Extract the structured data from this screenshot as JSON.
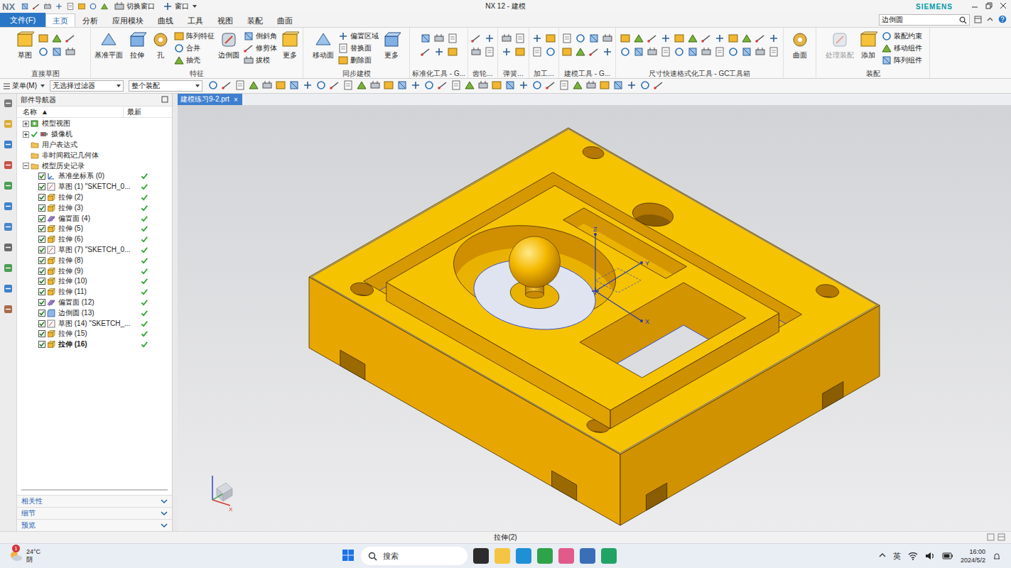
{
  "titlebar": {
    "logo": "NX",
    "quick_access": [
      {
        "label": "切换窗口"
      },
      {
        "label": "窗口"
      }
    ],
    "title": "NX 12 - 建模",
    "brand": "SIEMENS"
  },
  "menu": {
    "file": "文件(F)",
    "tabs": [
      {
        "label": "主页",
        "selected": true
      },
      {
        "label": "分析",
        "selected": false
      },
      {
        "label": "应用模块",
        "selected": false
      },
      {
        "label": "曲线",
        "selected": false
      },
      {
        "label": "工具",
        "selected": false
      },
      {
        "label": "视图",
        "selected": false
      },
      {
        "label": "装配",
        "selected": false
      },
      {
        "label": "曲面",
        "selected": false
      }
    ],
    "search": {
      "value": "边倒圆"
    }
  },
  "ribbon": {
    "groups": [
      {
        "label": "直接草图",
        "buttons": [
          {
            "label": "草图",
            "kind": "large",
            "disabled": false
          }
        ]
      },
      {
        "label": "特征",
        "buttons": [
          {
            "label": "基准平面",
            "kind": "large",
            "disabled": false
          },
          {
            "label": "拉伸",
            "kind": "large",
            "disabled": false
          },
          {
            "label": "孔",
            "kind": "large",
            "disabled": false
          },
          {
            "label": "阵列特征",
            "kind": "small",
            "disabled": false
          },
          {
            "label": "合并",
            "kind": "small",
            "disabled": false
          },
          {
            "label": "抽壳",
            "kind": "small",
            "disabled": false
          },
          {
            "label": "边倒圆",
            "kind": "large",
            "disabled": false
          },
          {
            "label": "倒斜角",
            "kind": "small",
            "disabled": false
          },
          {
            "label": "修剪体",
            "kind": "small",
            "disabled": false
          },
          {
            "label": "拔模",
            "kind": "small",
            "disabled": false
          },
          {
            "label": "更多",
            "kind": "large",
            "disabled": false
          }
        ]
      },
      {
        "label": "同步建模",
        "buttons": [
          {
            "label": "移动面",
            "kind": "large",
            "disabled": false
          },
          {
            "label": "偏置区域",
            "kind": "small",
            "disabled": false
          },
          {
            "label": "替换面",
            "kind": "small",
            "disabled": false
          },
          {
            "label": "删除面",
            "kind": "small",
            "disabled": false
          },
          {
            "label": "更多",
            "kind": "large",
            "disabled": false
          }
        ]
      },
      {
        "label": "标准化工具 - G...",
        "buttons": []
      },
      {
        "label": "齿轮...",
        "buttons": []
      },
      {
        "label": "弹簧...",
        "buttons": []
      },
      {
        "label": "加工...",
        "buttons": []
      },
      {
        "label": "建模工具 - G...",
        "buttons": []
      },
      {
        "label": "尺寸快速格式化工具 - GC工具箱",
        "buttons": []
      },
      {
        "buttons": [
          {
            "label": "曲面",
            "kind": "large",
            "disabled": false
          }
        ]
      },
      {
        "label": "装配",
        "buttons": [
          {
            "label": "处理装配",
            "kind": "large",
            "disabled": true
          },
          {
            "label": "添加",
            "kind": "large",
            "disabled": false
          },
          {
            "label": "装配约束",
            "kind": "small",
            "disabled": false
          },
          {
            "label": "移动组件",
            "kind": "small",
            "disabled": false
          },
          {
            "label": "阵列组件",
            "kind": "small",
            "disabled": false
          }
        ]
      }
    ]
  },
  "toolbar": {
    "menu": "菜单(M)",
    "filters": [
      {
        "value": "无选择过滤器"
      },
      {
        "value": "整个装配"
      }
    ]
  },
  "navigator": {
    "title": "部件导航器",
    "columns": [
      "名称",
      "最新"
    ],
    "sort": "▲",
    "items": [
      {
        "label": "模型视图",
        "kind": "views",
        "expanded": false
      },
      {
        "label": "摄像机",
        "kind": "camera",
        "expanded": false,
        "checked": true
      },
      {
        "label": "用户表达式",
        "kind": "folder"
      },
      {
        "label": "非时间戳记几何体",
        "kind": "folder"
      },
      {
        "label": "模型历史记录",
        "kind": "folder",
        "expanded": true,
        "children": [
          {
            "label": "基准坐标系 (0)",
            "kind": "datum",
            "checked": true,
            "latest": true,
            "current": false
          },
          {
            "label": "草图 (1) \"SKETCH_0...",
            "kind": "sketch",
            "checked": true,
            "latest": true,
            "current": false
          },
          {
            "label": "拉伸 (2)",
            "kind": "extrude",
            "checked": true,
            "latest": true,
            "current": false
          },
          {
            "label": "拉伸 (3)",
            "kind": "extrude",
            "checked": true,
            "latest": true,
            "current": false
          },
          {
            "label": "偏置面 (4)",
            "kind": "offset",
            "checked": true,
            "latest": true,
            "current": false
          },
          {
            "label": "拉伸 (5)",
            "kind": "extrude",
            "checked": true,
            "latest": true,
            "current": false
          },
          {
            "label": "拉伸 (6)",
            "kind": "extrude",
            "checked": true,
            "latest": true,
            "current": false
          },
          {
            "label": "草图 (7) \"SKETCH_0...",
            "kind": "sketch",
            "checked": true,
            "latest": true,
            "current": false
          },
          {
            "label": "拉伸 (8)",
            "kind": "extrude",
            "checked": true,
            "latest": true,
            "current": false
          },
          {
            "label": "拉伸 (9)",
            "kind": "extrude",
            "checked": true,
            "latest": true,
            "current": false
          },
          {
            "label": "拉伸 (10)",
            "kind": "extrude",
            "checked": true,
            "latest": true,
            "current": false
          },
          {
            "label": "拉伸 (11)",
            "kind": "extrude",
            "checked": true,
            "latest": true,
            "current": false
          },
          {
            "label": "偏置面 (12)",
            "kind": "offset",
            "checked": true,
            "latest": true,
            "current": false
          },
          {
            "label": "边倒圆 (13)",
            "kind": "blend",
            "checked": true,
            "latest": true,
            "current": false
          },
          {
            "label": "草图 (14) \"SKETCH_...",
            "kind": "sketch",
            "checked": true,
            "latest": true,
            "current": false
          },
          {
            "label": "拉伸 (15)",
            "kind": "extrude",
            "checked": true,
            "latest": true,
            "current": false
          },
          {
            "label": "拉伸 (16)",
            "kind": "extrude",
            "checked": true,
            "latest": true,
            "current": true
          }
        ]
      }
    ],
    "sections": [
      {
        "label": "相关性",
        "expanded": false
      },
      {
        "label": "细节",
        "expanded": false
      },
      {
        "label": "预览",
        "expanded": false
      }
    ]
  },
  "graphics": {
    "tab": {
      "label": "建模练习9-2.prt",
      "close": "×",
      "selected": true
    },
    "csys_labels": [
      "Z",
      "Y",
      "X"
    ],
    "triad_labels": [
      "X"
    ]
  },
  "status_bar": {
    "text": "拉伸(2)"
  },
  "taskbar": {
    "weather": {
      "badge": "1",
      "temp": "24°C",
      "condition": "阴"
    },
    "search": "搜索",
    "ime": "英",
    "time": "16:00",
    "date": "2024/5/2"
  }
}
